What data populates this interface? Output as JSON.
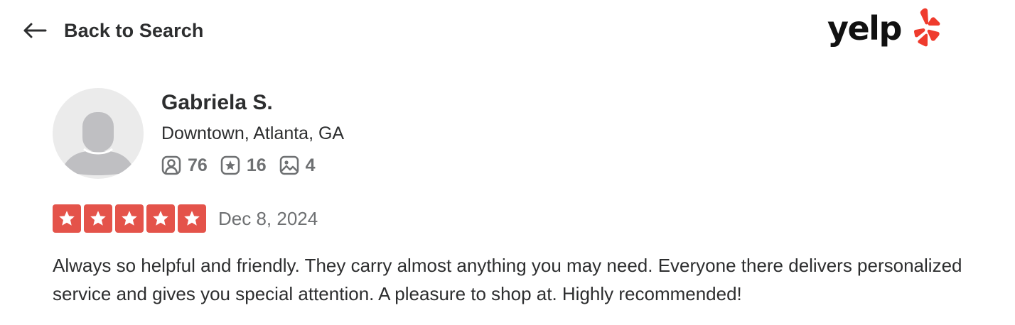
{
  "nav": {
    "back_label": "Back to Search"
  },
  "logo": {
    "text": "yelp"
  },
  "user": {
    "name": "Gabriela S.",
    "location": "Downtown, Atlanta, GA",
    "stats": [
      {
        "icon": "friends-icon",
        "value": "76"
      },
      {
        "icon": "reviews-star-icon",
        "value": "16"
      },
      {
        "icon": "photos-icon",
        "value": "4"
      }
    ]
  },
  "review": {
    "rating": 5,
    "rating_max": 5,
    "date": "Dec 8, 2024",
    "text": "Always so helpful and friendly. They carry almost anything you may need. Everyone there delivers personalized service and gives you special attention. A pleasure to shop at. Highly recommended!"
  },
  "colors": {
    "star_red": "#e4534a",
    "muted_text": "#6e7072",
    "primary_text": "#2d2e2f",
    "avatar_bg": "#ebebeb",
    "avatar_figure": "#bfbfc2"
  }
}
